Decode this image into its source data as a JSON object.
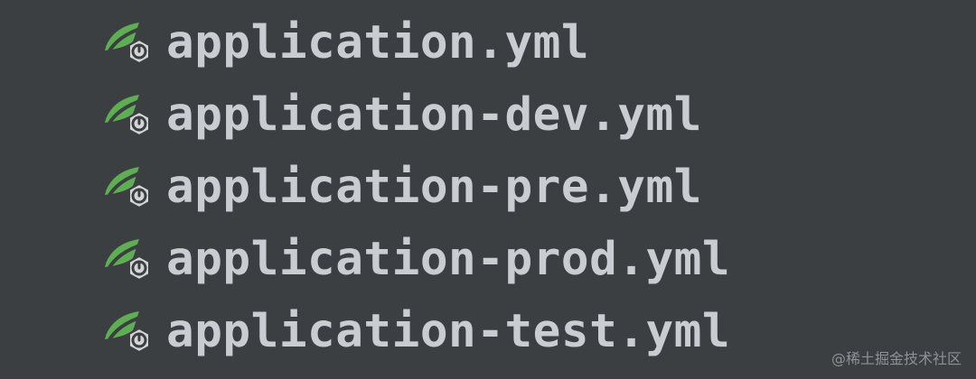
{
  "files": [
    {
      "name": "application.yml",
      "icon": "spring-boot-config-icon"
    },
    {
      "name": "application-dev.yml",
      "icon": "spring-boot-config-icon"
    },
    {
      "name": "application-pre.yml",
      "icon": "spring-boot-config-icon"
    },
    {
      "name": "application-prod.yml",
      "icon": "spring-boot-config-icon"
    },
    {
      "name": "application-test.yml",
      "icon": "spring-boot-config-icon"
    }
  ],
  "watermark": "@稀土掘金技术社区",
  "colors": {
    "background": "#3c3f41",
    "text": "#c9cdd1",
    "leaf": "#5fae54",
    "gear": "#d3d5d7"
  }
}
